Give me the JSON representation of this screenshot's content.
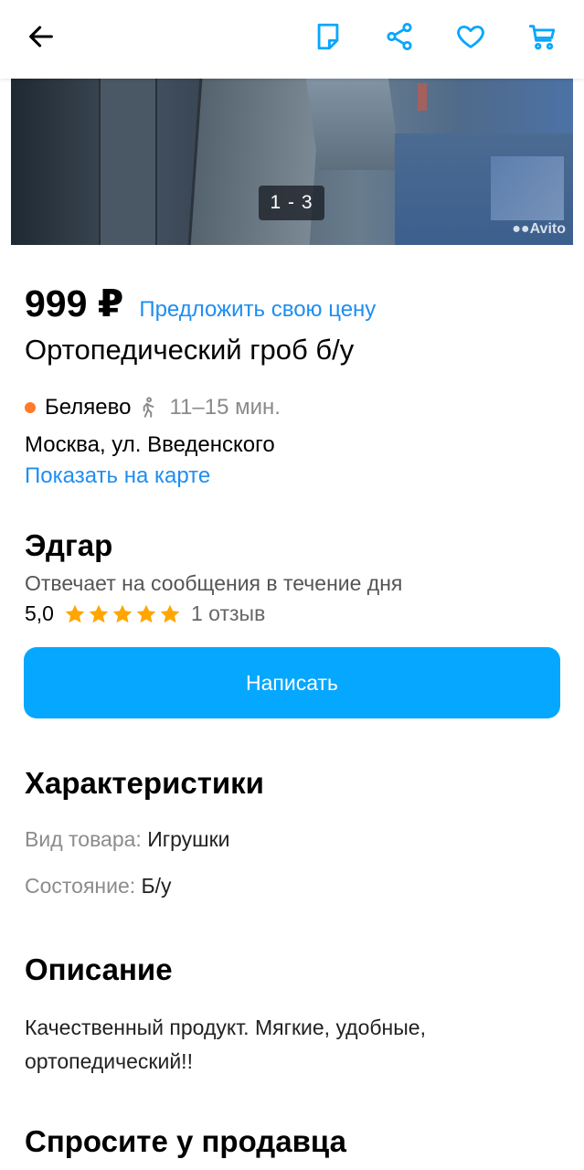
{
  "header": {
    "back_icon": "arrow-left-icon",
    "notes_icon": "note-icon",
    "share_icon": "share-icon",
    "favorite_icon": "heart-icon",
    "cart_icon": "cart-icon",
    "accent_color": "#06a7ff"
  },
  "gallery": {
    "counter": "1 - 3",
    "watermark": "Avito"
  },
  "listing": {
    "price": "999 ₽",
    "offer_price_link": "Предложить свою цену",
    "title": "Ортопедический гроб б/у"
  },
  "location": {
    "metro_station": "Беляево",
    "metro_color": "#ff7a2a",
    "walk_time": "11–15 мин.",
    "address": "Москва, ул. Введенского",
    "map_link": "Показать на карте"
  },
  "seller": {
    "name": "Эдгар",
    "response_time": "Отвечает на сообщения в течение дня",
    "rating_value": "5,0",
    "stars": 5,
    "reviews_link": "1 отзыв",
    "write_button": "Написать"
  },
  "characteristics": {
    "heading": "Характеристики",
    "items": [
      {
        "key": "Вид товара:",
        "value": "Игрушки"
      },
      {
        "key": "Состояние:",
        "value": "Б/у"
      }
    ]
  },
  "description": {
    "heading": "Описание",
    "text": "Качественный продукт. Мягкие, удобные, ортопедический!!"
  },
  "ask_seller": {
    "heading": "Спросите у продавца"
  }
}
